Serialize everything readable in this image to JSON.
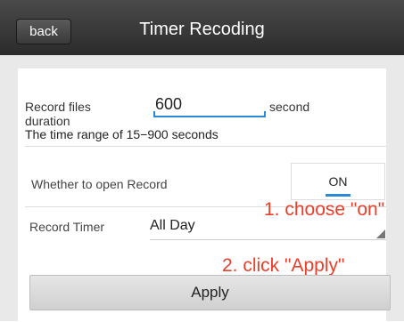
{
  "header": {
    "back_label": "back",
    "title": "Timer Recoding"
  },
  "form": {
    "duration_label": "Record files duration",
    "duration_value": "600",
    "duration_unit": "second",
    "range_hint": "The time range of 15−900 seconds",
    "open_record_label": "Whether to open Record",
    "open_record_value": "ON",
    "timer_label": "Record Timer",
    "timer_value": "All Day",
    "apply_label": "Apply"
  },
  "annotations": {
    "step1": "1. choose \"on\"",
    "step2": "2. click \"Apply\""
  },
  "colors": {
    "accent": "#2b8ad8",
    "annotation": "#e8402a",
    "header": "#333333"
  },
  "icons": {
    "dropdown": "dropdown-corner-icon"
  }
}
